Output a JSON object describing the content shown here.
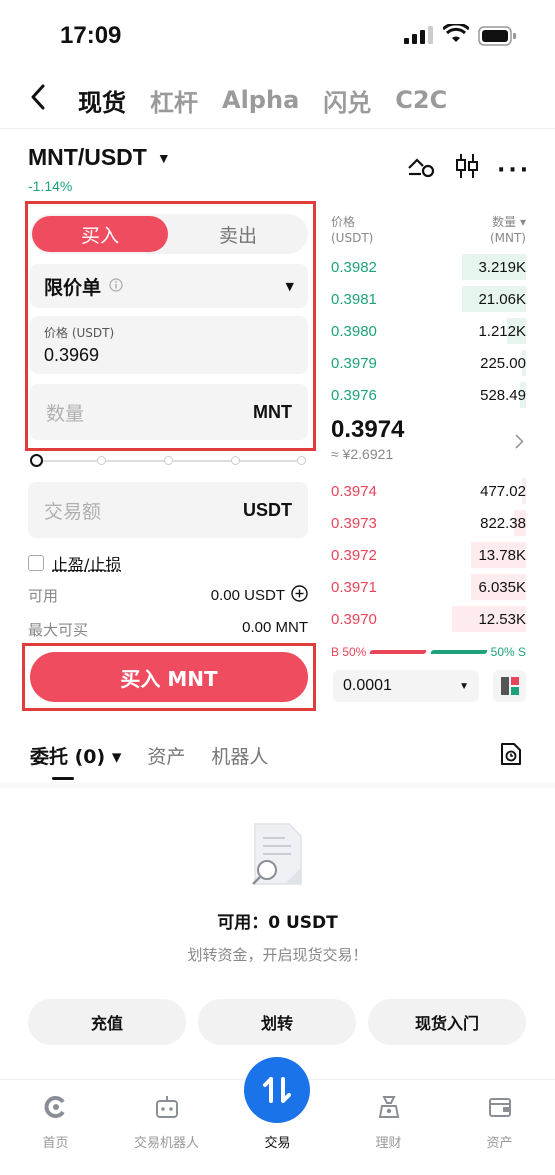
{
  "status_bar": {
    "time": "17:09"
  },
  "nav": {
    "back": "<",
    "tabs": [
      "现货",
      "杠杆",
      "Alpha",
      "闪兑",
      "C2C"
    ]
  },
  "pair": {
    "symbol": "MNT/USDT",
    "change": "-1.14%"
  },
  "order_form": {
    "buy_label": "买入",
    "sell_label": "卖出",
    "order_type": "限价单",
    "price_label": "价格 (USDT)",
    "price_value": "0.3969",
    "qty_placeholder": "数量",
    "qty_unit": "MNT",
    "total_placeholder": "交易额",
    "total_unit": "USDT",
    "tpsl_label": "止盈/止损",
    "available_label": "可用",
    "available_value": "0.00 USDT",
    "max_label": "最大可买",
    "max_value": "0.00 MNT",
    "submit_label": "买入 MNT"
  },
  "orderbook": {
    "price_header": "价格",
    "price_unit": "(USDT)",
    "qty_header": "数量 ▾",
    "qty_unit": "(MNT)",
    "asks": [
      {
        "price": "0.3982",
        "qty": "3.219K",
        "depth": 0.33
      },
      {
        "price": "0.3981",
        "qty": "21.06K",
        "depth": 0.33
      },
      {
        "price": "0.3980",
        "qty": "1.212K",
        "depth": 0.1
      },
      {
        "price": "0.3979",
        "qty": "225.00",
        "depth": 0.02
      },
      {
        "price": "0.3976",
        "qty": "528.49",
        "depth": 0.03
      }
    ],
    "mid_price": "0.3974",
    "mid_fiat": "≈ ¥2.6921",
    "bids": [
      {
        "price": "0.3974",
        "qty": "477.02",
        "depth": 0.02
      },
      {
        "price": "0.3973",
        "qty": "822.38",
        "depth": 0.06
      },
      {
        "price": "0.3972",
        "qty": "13.78K",
        "depth": 0.28
      },
      {
        "price": "0.3971",
        "qty": "6.035K",
        "depth": 0.28
      },
      {
        "price": "0.3970",
        "qty": "12.53K",
        "depth": 0.38
      }
    ],
    "buy_ratio": "B 50%",
    "sell_ratio": "50% S",
    "precision": "0.0001"
  },
  "orders": {
    "tabs": [
      "委托 (0) ▾",
      "资产",
      "机器人"
    ],
    "empty_title": "可用：0 USDT",
    "empty_sub": "划转资金，开启现货交易！",
    "actions": [
      "充值",
      "划转",
      "现货入门"
    ]
  },
  "bottom_nav": [
    "首页",
    "交易机器人",
    "交易",
    "理财",
    "资产"
  ],
  "colors": {
    "accent_red": "#f04c60",
    "accent_green": "#1ca37a",
    "fab_blue": "#1a73e8"
  }
}
